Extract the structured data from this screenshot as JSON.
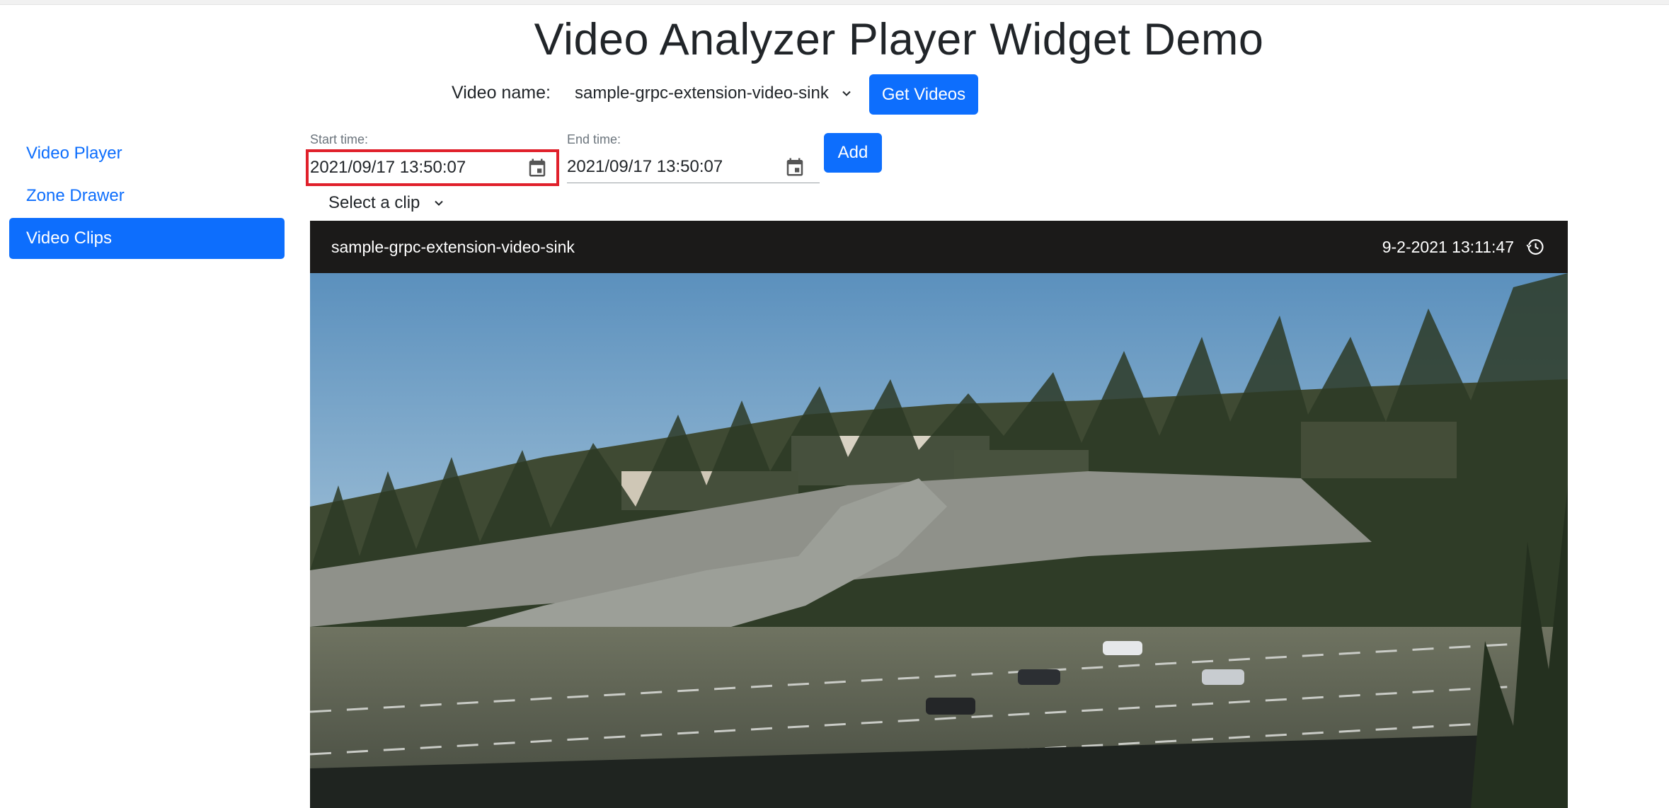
{
  "page": {
    "title": "Video Analyzer Player Widget Demo"
  },
  "video_picker": {
    "label": "Video name:",
    "selected": "sample-grpc-extension-video-sink",
    "get_button": "Get Videos"
  },
  "sidebar": {
    "items": [
      {
        "label": "Video Player",
        "active": false
      },
      {
        "label": "Zone Drawer",
        "active": false
      },
      {
        "label": "Video Clips",
        "active": true
      }
    ]
  },
  "clip_form": {
    "start_label": "Start time:",
    "start_value": "2021/09/17 13:50:07",
    "end_label": "End time:",
    "end_value": "2021/09/17 13:50:07",
    "add_button": "Add",
    "clip_select": "Select a clip"
  },
  "player": {
    "video_name": "sample-grpc-extension-video-sink",
    "timestamp": "9-2-2021 13:11:47",
    "icons": [
      "calendar-icon",
      "history-icon",
      "chevron-down-icon"
    ]
  },
  "colors": {
    "primary": "#0d6efd",
    "highlight": "#e0202b",
    "player_bar": "#1b1a19"
  }
}
